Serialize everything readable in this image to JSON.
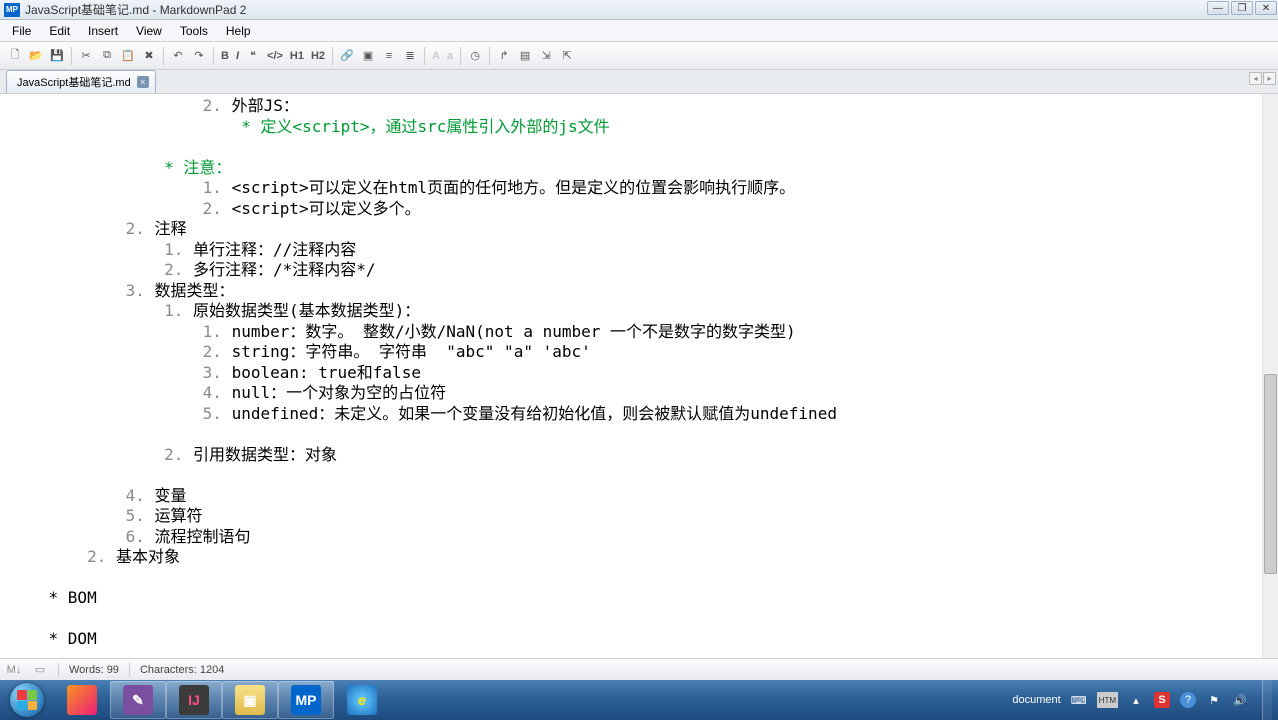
{
  "window": {
    "app_icon_label": "MP",
    "title": "JavaScript基础笔记.md - MarkdownPad 2"
  },
  "menu": {
    "items": [
      "File",
      "Edit",
      "Insert",
      "View",
      "Tools",
      "Help"
    ]
  },
  "toolbar": {
    "icons": [
      "new-file-icon",
      "open-file-icon",
      "save-icon",
      "sep",
      "cut-icon",
      "copy-icon",
      "paste-icon",
      "delete-icon",
      "sep",
      "undo-icon",
      "redo-icon",
      "sep",
      "bold-icon",
      "italic-icon",
      "quote-icon",
      "code-icon",
      "h1-icon",
      "h2-icon",
      "sep",
      "link-icon",
      "image-icon",
      "ul-icon",
      "ol-icon",
      "sep",
      "font-name-icon",
      "font-size-icon",
      "sep",
      "timestamp-icon",
      "sep",
      "browser-preview-icon",
      "toggle-preview-icon",
      "export-icon",
      "upload-icon"
    ]
  },
  "tabs": {
    "items": [
      {
        "label": "JavaScript基础笔记.md"
      }
    ]
  },
  "editor": {
    "lines": [
      {
        "indent": 10,
        "num": "2.",
        "text": "外部JS：",
        "cls": ""
      },
      {
        "indent": 12,
        "num": "",
        "text": "* 定义<script>，通过src属性引入外部的js文件",
        "cls": "green"
      },
      {
        "indent": 0,
        "num": "",
        "text": " ",
        "cls": ""
      },
      {
        "indent": 8,
        "num": "",
        "text": "* 注意：",
        "cls": "green"
      },
      {
        "indent": 10,
        "num": "1.",
        "text": "<script>可以定义在html页面的任何地方。但是定义的位置会影响执行顺序。",
        "cls": ""
      },
      {
        "indent": 10,
        "num": "2.",
        "text": "<script>可以定义多个。",
        "cls": ""
      },
      {
        "indent": 6,
        "num": "2.",
        "text": "注释",
        "cls": ""
      },
      {
        "indent": 8,
        "num": "1.",
        "text": "单行注释：//注释内容",
        "cls": ""
      },
      {
        "indent": 8,
        "num": "2.",
        "text": "多行注释：/*注释内容*/",
        "cls": ""
      },
      {
        "indent": 6,
        "num": "3.",
        "text": "数据类型：",
        "cls": ""
      },
      {
        "indent": 8,
        "num": "1.",
        "text": "原始数据类型(基本数据类型)：",
        "cls": ""
      },
      {
        "indent": 10,
        "num": "1.",
        "text": "number：数字。 整数/小数/NaN(not a number 一个不是数字的数字类型)",
        "cls": ""
      },
      {
        "indent": 10,
        "num": "2.",
        "text": "string：字符串。 字符串  \"abc\" \"a\" 'abc'",
        "cls": ""
      },
      {
        "indent": 10,
        "num": "3.",
        "text": "boolean: true和false",
        "cls": ""
      },
      {
        "indent": 10,
        "num": "4.",
        "text": "null：一个对象为空的占位符",
        "cls": ""
      },
      {
        "indent": 10,
        "num": "5.",
        "text": "undefined：未定义。如果一个变量没有给初始化值，则会被默认赋值为undefined",
        "cls": ""
      },
      {
        "indent": 0,
        "num": "",
        "text": " ",
        "cls": ""
      },
      {
        "indent": 8,
        "num": "2.",
        "text": "引用数据类型：对象",
        "cls": ""
      },
      {
        "indent": 0,
        "num": "",
        "text": " ",
        "cls": ""
      },
      {
        "indent": 6,
        "num": "4.",
        "text": "变量",
        "cls": ""
      },
      {
        "indent": 6,
        "num": "5.",
        "text": "运算符",
        "cls": ""
      },
      {
        "indent": 6,
        "num": "6.",
        "text": "流程控制语句",
        "cls": ""
      },
      {
        "indent": 4,
        "num": "2.",
        "text": "基本对象",
        "cls": ""
      },
      {
        "indent": 0,
        "num": "",
        "text": " ",
        "cls": ""
      },
      {
        "indent": 2,
        "num": "",
        "text": "* BOM",
        "cls": ""
      },
      {
        "indent": 0,
        "num": "",
        "text": " ",
        "cls": ""
      },
      {
        "indent": 2,
        "num": "",
        "text": "* DOM",
        "cls": ""
      }
    ]
  },
  "statusbar": {
    "words_label": "Words: 99",
    "chars_label": "Characters: 1204"
  },
  "tray": {
    "doc_label": "document",
    "htm_label": "HTM",
    "time": "",
    "date": ""
  }
}
